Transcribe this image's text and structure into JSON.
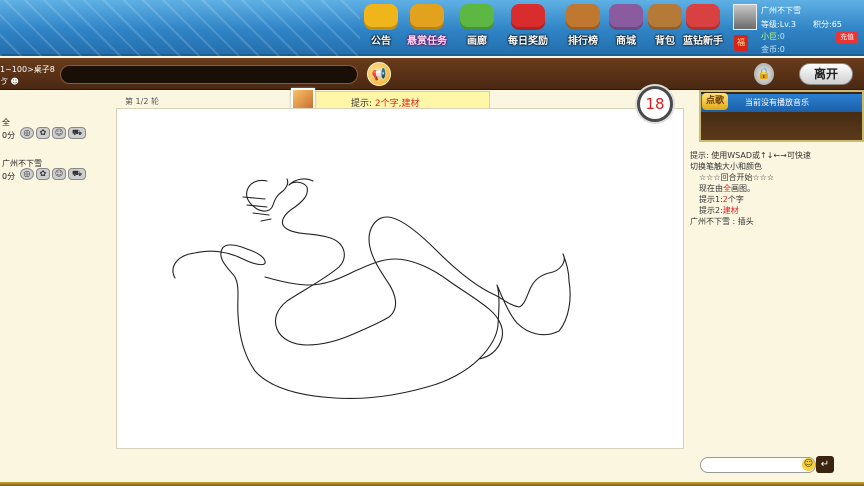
{
  "menu": [
    {
      "label": "公告",
      "icon": "megaphone-icon",
      "color": "#f1b51c",
      "pink": false
    },
    {
      "label": "悬赏任务",
      "icon": "money-bag-icon",
      "color": "#e3a21d",
      "pink": true
    },
    {
      "label": "画廊",
      "icon": "cards-icon",
      "color": "#5cb843",
      "pink": false
    },
    {
      "label": "每日奖励",
      "icon": "gift-box-icon",
      "color": "#d92c2c",
      "pink": false
    },
    {
      "label": "排行榜",
      "icon": "trophy-icon",
      "color": "#c0772f",
      "pink": false
    },
    {
      "label": "商城",
      "icon": "store-icon",
      "color": "#8a5b9e",
      "pink": false
    },
    {
      "label": "背包",
      "icon": "backpack-icon",
      "color": "#b57a38",
      "pink": false
    },
    {
      "label": "蓝钻新手",
      "icon": "blue-diamond-gift-icon",
      "color": "#d94040",
      "pink": false
    }
  ],
  "user": {
    "name": "广州不下雪",
    "level_label": "等级:",
    "level_value": "Lv.3",
    "score_label": "积分:",
    "score_value": "65",
    "xiaoju_label": "小巨:",
    "xiaoju_value": "0",
    "gold_label": "金币:",
    "gold_value": "0",
    "recharge": "充值",
    "bag_glyph": "福"
  },
  "room": {
    "line1": "1~100>桌子8",
    "line2": "ゔ ☻"
  },
  "buttons": {
    "leave": "离开",
    "dian": "点歌"
  },
  "players": [
    {
      "name": "全",
      "score": "0分"
    },
    {
      "name": "广州不下雪",
      "score": "0分"
    }
  ],
  "game": {
    "round": "第 1/2 轮",
    "hint_prefix": "提示:",
    "hint_value": "2个字,建材",
    "timer": "18"
  },
  "music": {
    "status": "当前没有播放音乐"
  },
  "chat": {
    "tip_line1": "提示: 使用WSAD或↑↓←→可快速",
    "tip_line2": "切换笔触大小和颜色",
    "round_start": "☆☆☆回合开始☆☆☆",
    "now_prefix": "现在由",
    "now_name": "全",
    "now_suffix": "画图。",
    "hint1_prefix": "提示1:",
    "hint1_value": "2",
    "hint1_suffix": "个字",
    "hint2_prefix": "提示2:",
    "hint2_value": "建材",
    "guess_name": "广州不下雪",
    "guess_sep": ":",
    "guess_text": "插头"
  },
  "colors": {
    "accent_red": "#e02020",
    "topbar_blue": "#2f84c6",
    "bar_brown": "#4a2812"
  }
}
